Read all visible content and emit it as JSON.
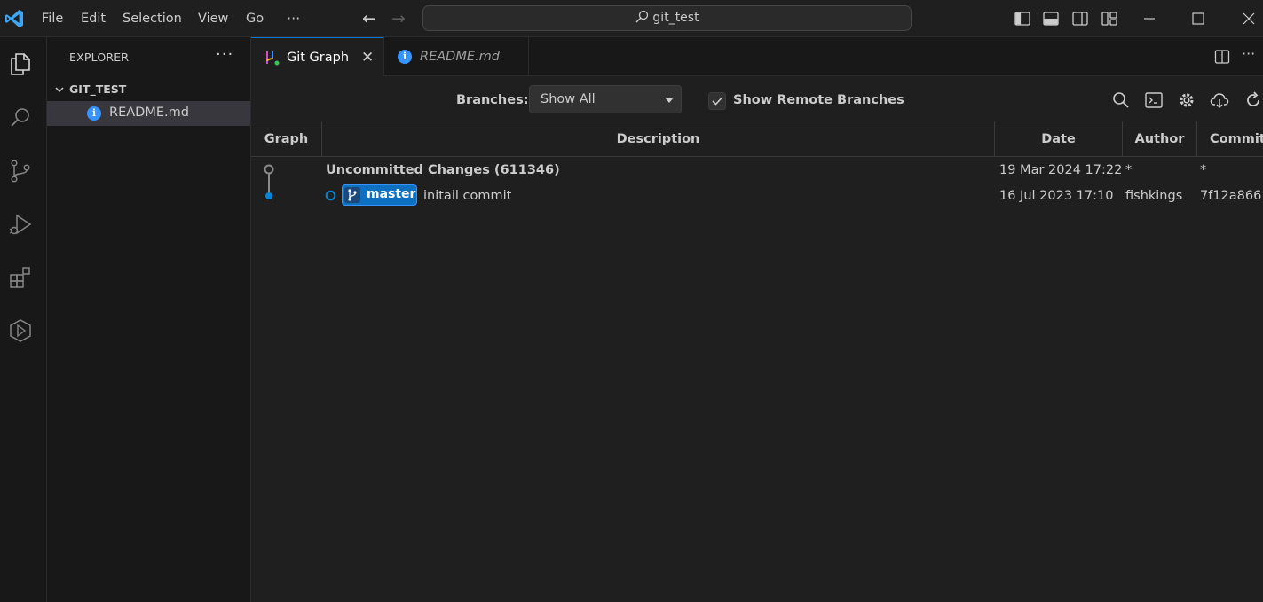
{
  "titlebar": {
    "menus": [
      "File",
      "Edit",
      "Selection",
      "View",
      "Go"
    ],
    "more": "···",
    "search_text": "git_test"
  },
  "sidebar": {
    "title": "EXPLORER",
    "more": "···",
    "folder": "GIT_TEST",
    "files": [
      {
        "name": "README.md",
        "icon": "info-icon"
      }
    ]
  },
  "tabs": [
    {
      "label": "Git Graph",
      "icon": "git-graph-icon",
      "active": true
    },
    {
      "label": "README.md",
      "icon": "info-icon",
      "active": false
    }
  ],
  "gitgraph": {
    "branches_label": "Branches:",
    "branches_value": "Show All",
    "remote_label": "Show Remote Branches",
    "remote_checked": true,
    "columns": [
      "Graph",
      "Description",
      "Date",
      "Author",
      "Commit"
    ],
    "rows": [
      {
        "description": "Uncommitted Changes (611346)",
        "date": "19 Mar 2024 17:22",
        "author": "*",
        "commit": "*"
      },
      {
        "ref": "master",
        "description": "initail commit",
        "date": "16 Jul 2023 17:10",
        "author": "fishkings",
        "commit": "7f12a866"
      }
    ]
  },
  "colors": {
    "accent": "#0078d4",
    "badge": "#0e70c0",
    "graph_line": "#8b8b8b",
    "graph_commit": "#0085d9"
  }
}
